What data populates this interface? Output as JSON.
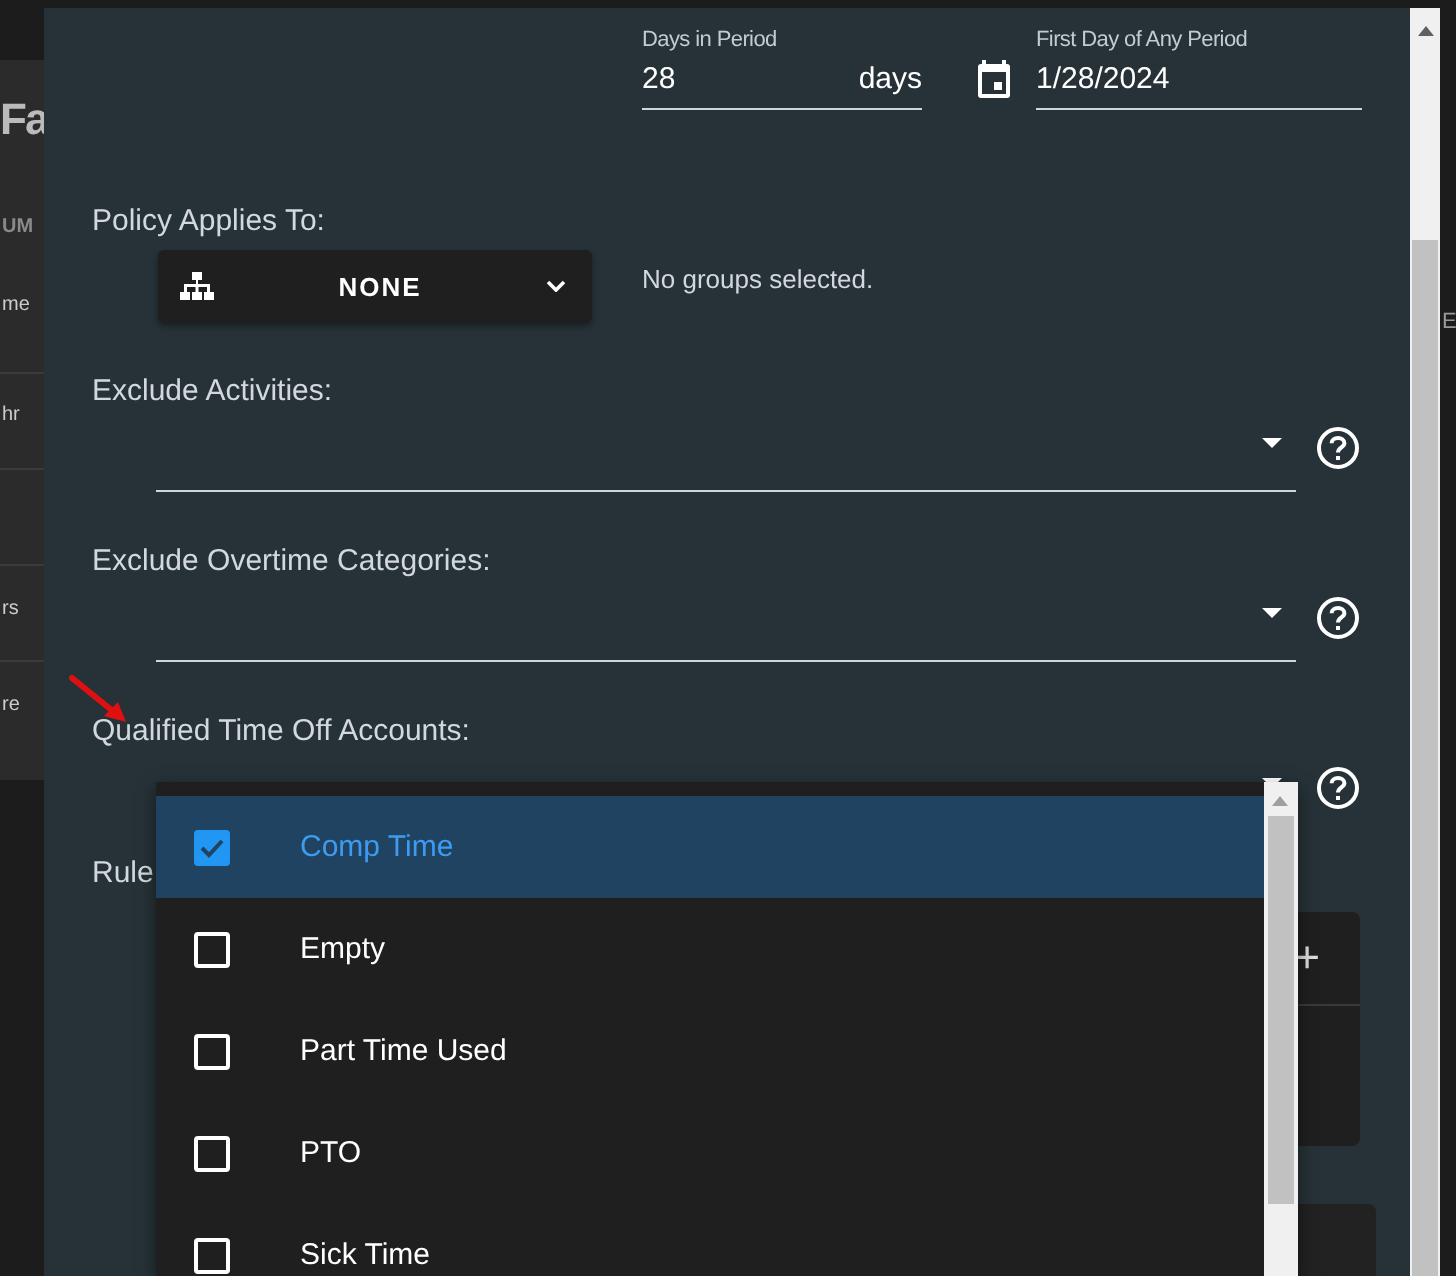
{
  "background_page": {
    "title_fragment": "Fa",
    "column_fragment": "UM",
    "row_fragments": [
      "me",
      "hr",
      "rs",
      "re"
    ],
    "right_fragment": "E"
  },
  "period": {
    "days_label": "Days in Period",
    "days_value": "28",
    "days_suffix": "days",
    "first_day_label": "First Day of Any Period",
    "first_day_value": "1/28/2024"
  },
  "policy_applies_to": {
    "label": "Policy Applies To:",
    "button": "NONE",
    "status": "No groups selected."
  },
  "selects": [
    {
      "label": "Exclude Activities:"
    },
    {
      "label": "Exclude Overtime Categories:"
    },
    {
      "label": "Qualified Time Off Accounts:",
      "expanded": true,
      "options": [
        {
          "label": "Comp Time",
          "checked": true,
          "selected": true
        },
        {
          "label": "Empty",
          "checked": false,
          "selected": false
        },
        {
          "label": "Part Time Used",
          "checked": false,
          "selected": false
        },
        {
          "label": "PTO",
          "checked": false,
          "selected": false
        },
        {
          "label": "Sick Time",
          "checked": false,
          "selected": false
        }
      ]
    }
  ],
  "rules": {
    "label": "Rule",
    "add_button": "+"
  }
}
